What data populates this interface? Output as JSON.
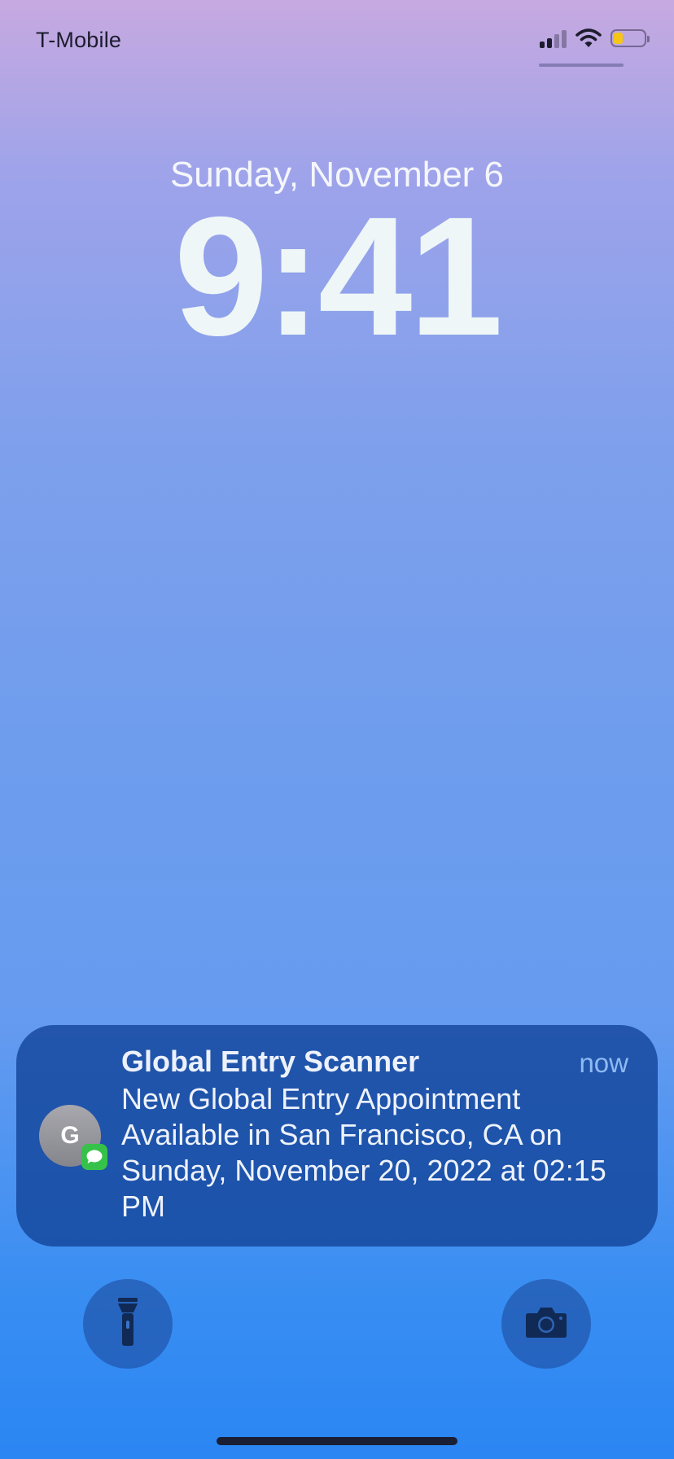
{
  "status_bar": {
    "carrier": "T-Mobile",
    "signal_icon": "cellular-signal-icon",
    "signal_bars": 2,
    "signal_bars_max": 4,
    "wifi_icon": "wifi-icon",
    "battery_icon": "battery-icon",
    "battery_level": 0.3,
    "battery_color": "#f5c518"
  },
  "lock_screen": {
    "date": "Sunday, November 6",
    "time": "9:41"
  },
  "notification": {
    "avatar_initial": "G",
    "badge_icon": "messages-icon",
    "title": "Global Entry Scanner",
    "time": "now",
    "body": "New Global Entry Appointment Available in San Francisco, CA on Sunday, November 20, 2022 at 02:15 PM"
  },
  "quick_actions": {
    "left_icon": "flashlight-icon",
    "right_icon": "camera-icon"
  },
  "colors": {
    "accent": "#1c56a6",
    "badge_green": "#36c24a"
  }
}
